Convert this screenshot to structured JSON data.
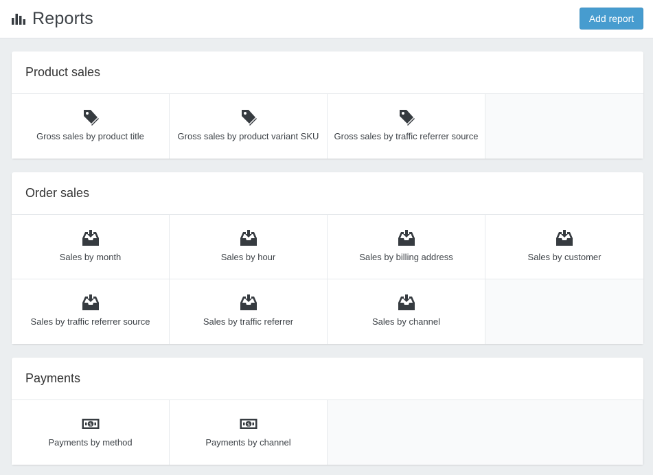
{
  "header": {
    "title": "Reports",
    "title_icon": "bar-chart-icon",
    "add_button_label": "Add report"
  },
  "colors": {
    "accent": "#479ccf",
    "icon": "#363b40"
  },
  "sections": [
    {
      "title": "Product sales",
      "icon": "tag-icon",
      "items": [
        "Gross sales by product title",
        "Gross sales by product variant SKU",
        "Gross sales by traffic referrer source"
      ]
    },
    {
      "title": "Order sales",
      "icon": "inbox-download-icon",
      "items": [
        "Sales by month",
        "Sales by hour",
        "Sales by billing address",
        "Sales by customer",
        "Sales by traffic referrer source",
        "Sales by traffic referrer",
        "Sales by channel"
      ]
    },
    {
      "title": "Payments",
      "icon": "money-icon",
      "items": [
        "Payments by method",
        "Payments by channel"
      ]
    }
  ]
}
